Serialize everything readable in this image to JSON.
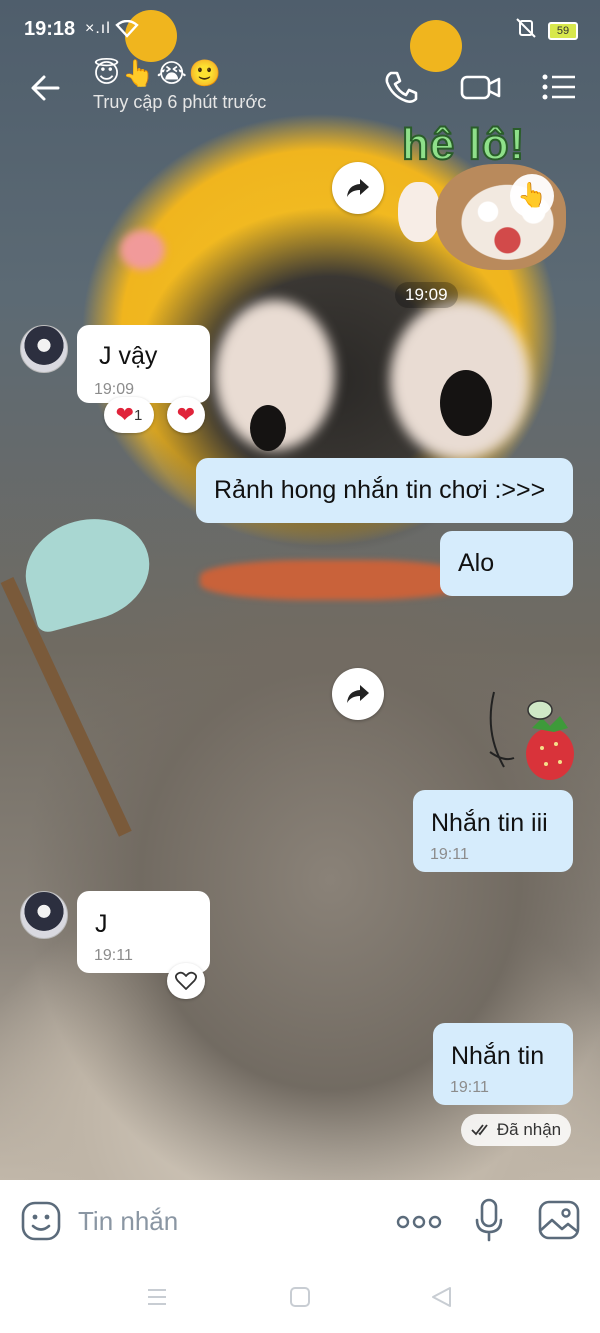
{
  "status_bar": {
    "time": "19:18",
    "signal": "×.ıl",
    "battery": "59"
  },
  "header": {
    "emojis": "😇👆😭🙂",
    "subtitle": "Truy cập 6 phút trước"
  },
  "sticker": {
    "text": "hê lô!",
    "time": "19:09"
  },
  "messages": [
    {
      "side": "in",
      "text": "J vậy",
      "time": "19:09",
      "reactions": [
        {
          "icon": "heart",
          "count": "1"
        },
        {
          "icon": "heart"
        }
      ]
    },
    {
      "side": "out",
      "text": "Rảnh hong nhắn tin chơi :>>>"
    },
    {
      "side": "out",
      "text": "Alo"
    },
    {
      "side": "out",
      "text": "Nhắn tin iii",
      "time": "19:11"
    },
    {
      "side": "in",
      "text": "J",
      "time": "19:11"
    },
    {
      "side": "out",
      "text": "Nhắn tin",
      "time": "19:11"
    }
  ],
  "seen_label": "Đã nhận",
  "input": {
    "placeholder": "Tin nhắn"
  },
  "colors": {
    "incoming_bubble": "#ffffff",
    "outgoing_bubble": "#d6ecfc",
    "accent_icon": "#5b6b7b"
  }
}
